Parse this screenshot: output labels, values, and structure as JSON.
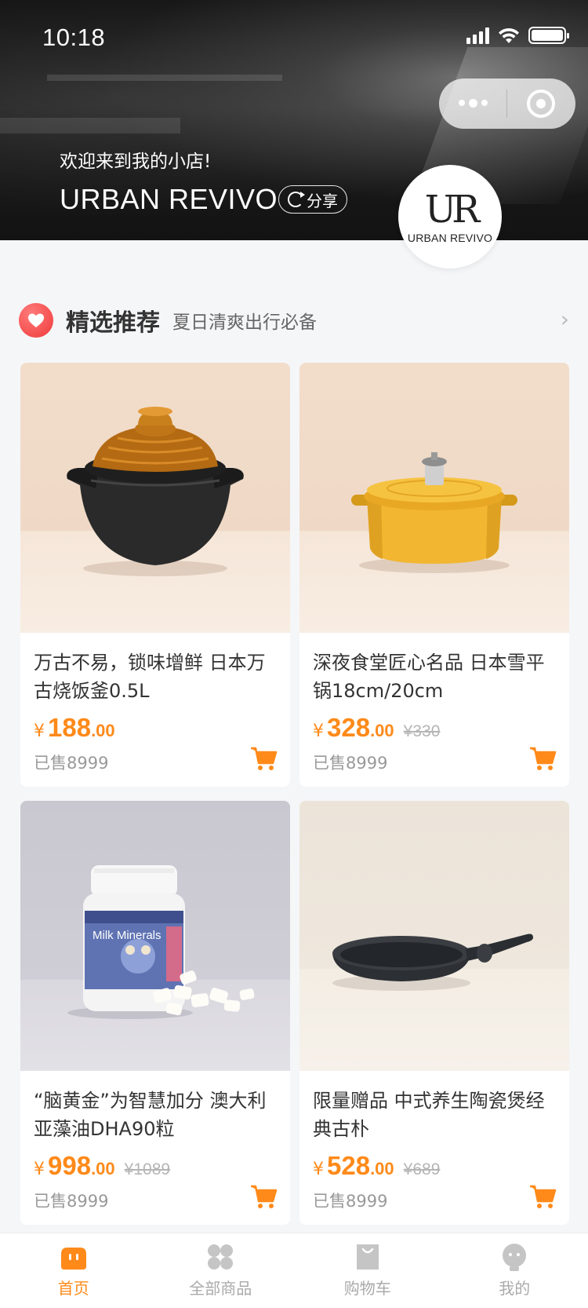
{
  "status_bar": {
    "time": "10:18"
  },
  "header": {
    "welcome": "欢迎来到我的小店!",
    "shop_name": "URBAN REVIVO",
    "share_label": "分享",
    "logo_mark": "UR",
    "logo_text": "URBAN REVIVO"
  },
  "section": {
    "title": "精选推荐",
    "subtitle": "夏日清爽出行必备",
    "arrow": "›"
  },
  "products": [
    {
      "title": "万古不易，锁味增鲜 日本万古烧饭釜0.5L",
      "currency": "¥",
      "price_int": "188",
      "price_dec": ".00",
      "orig_price": "",
      "sold": "已售8999",
      "image": "clay-pot"
    },
    {
      "title": "深夜食堂匠心名品 日本雪平锅18cm/20cm",
      "currency": "¥",
      "price_int": "328",
      "price_dec": ".00",
      "orig_price": "¥330",
      "sold": "已售8999",
      "image": "yellow-casserole"
    },
    {
      "title": "“脑黄金”为智慧加分 澳大利亚藻油DHA90粒",
      "currency": "¥",
      "price_int": "998",
      "price_dec": ".00",
      "orig_price": "¥1089",
      "sold": "已售8999",
      "image": "supplement-bottle",
      "bottle_label": "Milk Minerals"
    },
    {
      "title": "限量赠品 中式养生陶瓷煲经典古朴",
      "currency": "¥",
      "price_int": "528",
      "price_dec": ".00",
      "orig_price": "¥689",
      "sold": "已售8999",
      "image": "frying-pan"
    }
  ],
  "tabbar": {
    "items": [
      {
        "label": "首页",
        "icon": "home-icon",
        "active": true
      },
      {
        "label": "全部商品",
        "icon": "grid-icon",
        "active": false
      },
      {
        "label": "购物车",
        "icon": "bag-icon",
        "active": false
      },
      {
        "label": "我的",
        "icon": "user-icon",
        "active": false
      }
    ]
  },
  "colors": {
    "accent": "#ff8a1a",
    "badge": "#ef3a3a"
  }
}
